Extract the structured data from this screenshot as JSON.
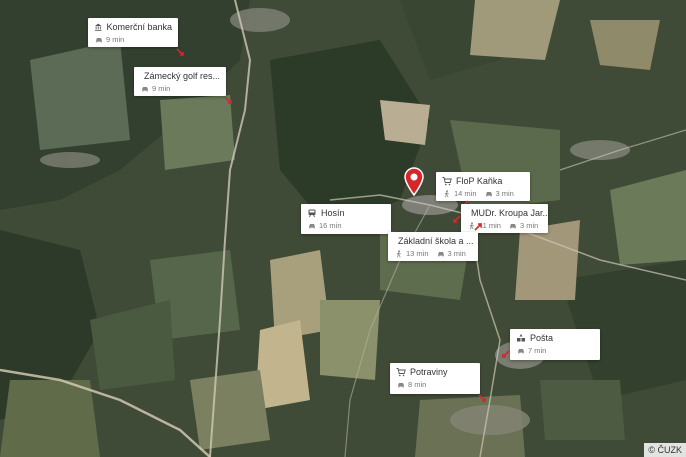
{
  "map": {
    "copyright": "© ČUZK"
  },
  "pois": [
    {
      "name": "Komerční banka",
      "icon": "bank-icon",
      "modes": [
        {
          "icon": "car-icon",
          "time": "9 min"
        }
      ]
    },
    {
      "name": "Zámecký golf res...",
      "icon": "restaurant-icon",
      "modes": [
        {
          "icon": "car-icon",
          "time": "9 min"
        }
      ]
    },
    {
      "name": "FloP Kaňka",
      "icon": "shop-icon",
      "modes": [
        {
          "icon": "walk-icon",
          "time": "14 min"
        },
        {
          "icon": "car-icon",
          "time": "3 min"
        }
      ]
    },
    {
      "name": "MUDr. Kroupa Jar...",
      "icon": "medical-icon",
      "modes": [
        {
          "icon": "walk-icon",
          "time": "11 min"
        },
        {
          "icon": "car-icon",
          "time": "3 min"
        }
      ]
    },
    {
      "name": "Hosín",
      "icon": "station-icon",
      "modes": [
        {
          "icon": "car-icon",
          "time": "16 min"
        }
      ]
    },
    {
      "name": "Základní škola a ...",
      "icon": "school-icon",
      "modes": [
        {
          "icon": "walk-icon",
          "time": "13 min"
        },
        {
          "icon": "car-icon",
          "time": "3 min"
        }
      ]
    },
    {
      "name": "Pošta",
      "icon": "post-icon",
      "modes": [
        {
          "icon": "car-icon",
          "time": "7 min"
        }
      ]
    },
    {
      "name": "Potraviny",
      "icon": "shop-icon",
      "modes": [
        {
          "icon": "car-icon",
          "time": "8 min"
        }
      ]
    }
  ]
}
